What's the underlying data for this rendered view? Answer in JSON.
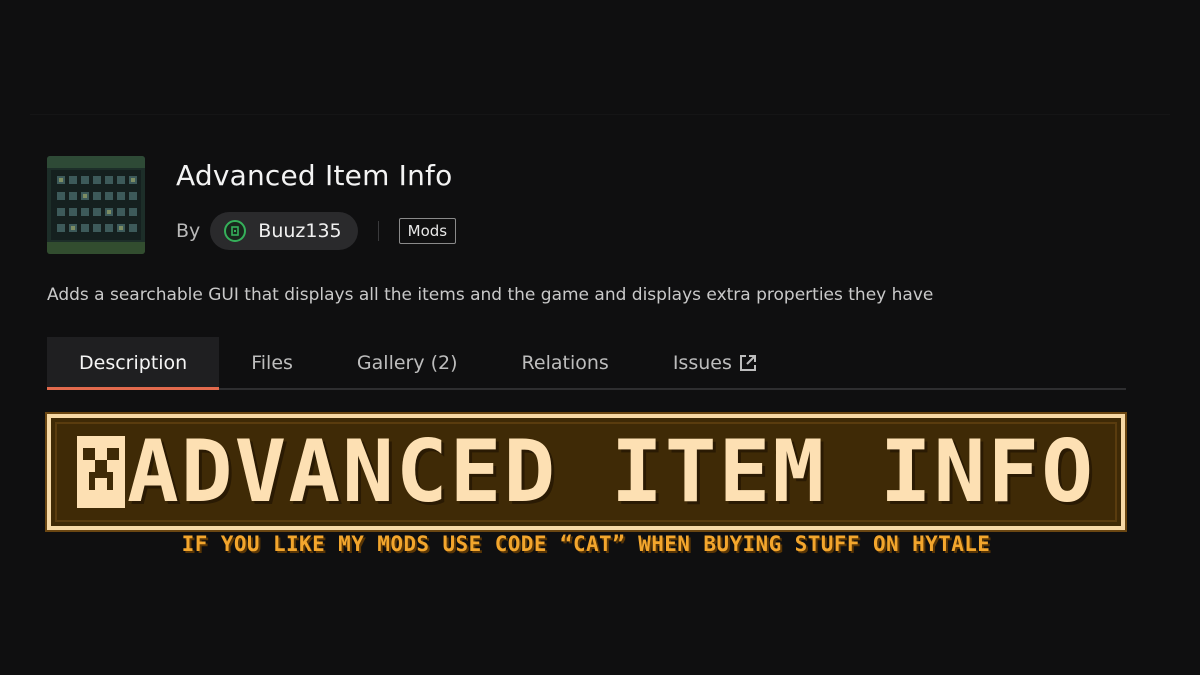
{
  "project": {
    "title": "Advanced Item Info",
    "by_label": "By",
    "author": "Buuz135",
    "tag": "Mods",
    "summary": "Adds a searchable GUI that displays all the items and the game and displays extra properties they have"
  },
  "tabs": [
    {
      "label": "Description",
      "active": true
    },
    {
      "label": "Files",
      "active": false
    },
    {
      "label": "Gallery (2)",
      "active": false
    },
    {
      "label": "Relations",
      "active": false
    },
    {
      "label": "Issues",
      "active": false,
      "icon": "external-link-icon"
    }
  ],
  "banner": {
    "title": "ADVANCED ITEM INFO",
    "subtitle": "IF YOU LIKE MY MODS USE CODE “CAT” WHEN BUYING STUFF ON HYTALE"
  },
  "colors": {
    "background": "#0f0f10",
    "active_tab_underline": "#e26a4d",
    "banner_fill": "#3f2a06",
    "banner_text": "#fde0b3",
    "banner_subtitle": "#f3a62d",
    "author_avatar_ring": "#35b05a"
  },
  "icons": {
    "author_avatar": "author-avatar-icon",
    "issues": "external-link-icon",
    "banner_face": "creeper-face-icon"
  }
}
